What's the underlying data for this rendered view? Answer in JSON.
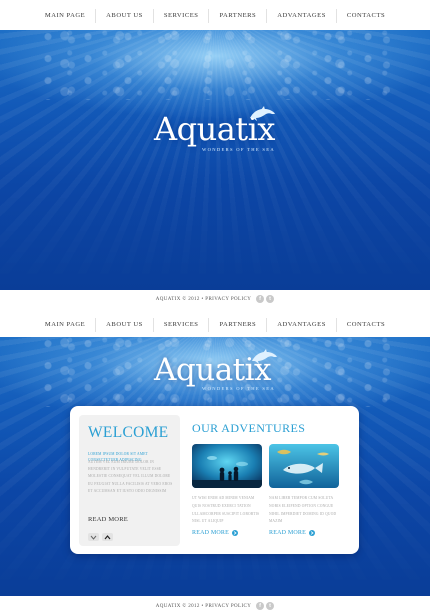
{
  "nav": {
    "items": [
      "MAIN PAGE",
      "ABOUT US",
      "SERVICES",
      "PARTNERS",
      "ADVANTAGES",
      "CONTACTS"
    ]
  },
  "logo": {
    "title": "Aquatix",
    "tagline": "WONDERS OF THE SEA"
  },
  "footer": {
    "text": "AQUATIX © 2012 • PRIVACY POLICY",
    "social": [
      "f",
      "t"
    ]
  },
  "welcome": {
    "title": "WELCOME",
    "lead": "LOREM IPSUM DOLOR SIT AMET CONSECTETUER ADIPISCING",
    "body": "AUTEM VEL EUM IRIURE DOLOR IN HENDRERIT IN VULPUTATE VELIT ESSE MOLESTIE CONSEQUAT VEL ILLUM DOLORE EU FEUGIAT NULLA FACILISIS AT VERO EROS ET ACCUMSAN ET IUSTO ODIO DIGNISSIM",
    "read_more": "READ MORE"
  },
  "adventures": {
    "title": "OUR ADVENTURES",
    "cards": [
      {
        "text": "UT WISI ENIM AD MINIM VENIAM QUIS NOSTRUD EXERCI TATION ULLAMCORPER SUSCIPIT LOBORTIS NISL UT ALIQUIP",
        "read_more": "READ MORE"
      },
      {
        "text": "NAM LIBER TEMPOR CUM SOLUTA NOBIS ELEIFEND OPTION CONGUE NIHIL IMPERDIET DOMING ID QUOD MAZIM",
        "read_more": "READ MORE"
      }
    ]
  },
  "colors": {
    "accent": "#2a9fd3",
    "ocean_deep": "#0a3d98",
    "ocean_light": "#1e6fc6"
  }
}
